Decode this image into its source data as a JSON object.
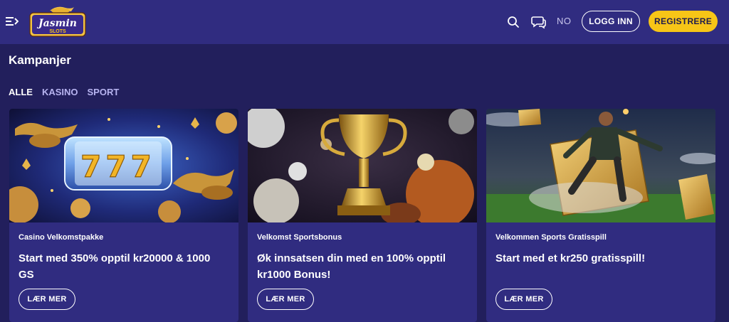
{
  "header": {
    "logo_text": "Jasmin",
    "logo_subtext": "SLOTS",
    "lang": "NO",
    "login_label": "LOGG INN",
    "register_label": "REGISTRERE",
    "accent_color": "#f7c517"
  },
  "page": {
    "title": "Kampanjer"
  },
  "filters": [
    {
      "label": "ALLE",
      "active": true
    },
    {
      "label": "KASINO",
      "active": false
    },
    {
      "label": "SPORT",
      "active": false
    }
  ],
  "cards": [
    {
      "category": "Casino Velkomstpakke",
      "title": "Start med 350% opptil kr20000 & 1000 GS",
      "button": "LÆR MER",
      "image": "slot-machine-777-with-genie-lamps",
      "reel_digits": "777"
    },
    {
      "category": "Velkomst Sportsbonus",
      "title": "Øk innsatsen din med en 100% opptil kr1000 Bonus!",
      "button": "LÆR MER",
      "image": "golden-trophy-with-sports-balls"
    },
    {
      "category": "Velkommen Sports Gratisspill",
      "title": "Start med et kr250 gratisspill!",
      "button": "LÆR MER",
      "image": "football-player-kicking-with-golden-tickets"
    }
  ]
}
